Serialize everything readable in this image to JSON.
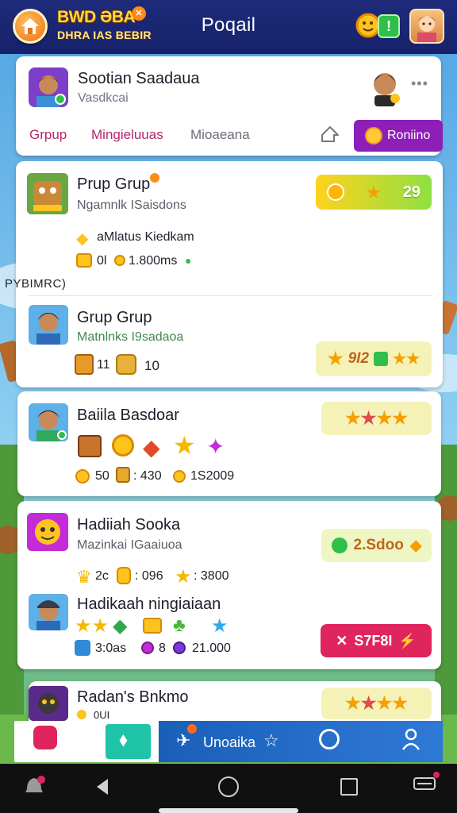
{
  "app": {
    "logo_line1": "BWD ƏBA",
    "logo_line2": "DHRA IAS BEBIR",
    "title": "Poqail"
  },
  "profile": {
    "name": "Sootian Saadaua",
    "subtitle": "Vasdkcai"
  },
  "tabs": [
    {
      "label": "Grpup"
    },
    {
      "label": "Mingieluuas"
    },
    {
      "label": "Mioaeana"
    }
  ],
  "promo_button": {
    "label": "Roniino"
  },
  "entries": [
    {
      "title": "Prup Grup",
      "subtitle": "Ngamnlk ISaisdons",
      "reward_label": "aMlatus Kiedkam",
      "stat_1": "0l",
      "stat_2": "1.800ms",
      "badge_value": "29"
    },
    {
      "title": "Grup Grup",
      "subtitle": "Matnlnks I9sadaoa",
      "stat_1": "11",
      "stat_2": "10",
      "badge_value": "9I2"
    },
    {
      "title": "Baiila Basdoar",
      "stat_1": "50",
      "stat_2": ": 430",
      "stat_3": "1S2009"
    },
    {
      "title": "Hadiiah Sooka",
      "subtitle": "Mazinkai IGaaiuoa",
      "stat_1": "2c",
      "stat_2": ": 096",
      "stat_3": ": 3800",
      "badge_value": "2.Sdoo"
    },
    {
      "title": "Hadikaah ningiaiaan",
      "stat_1": "3:0as",
      "stat_2": "8",
      "stat_3": "21.000",
      "badge_value": "S7F8I"
    },
    {
      "title": "Radan's Bnkmo",
      "stat_1": "0UI"
    }
  ],
  "section_label": "PYBIMRC)",
  "bottom_nav": {
    "active_label": "Unoaika"
  },
  "colors": {
    "header": "#1e2b7a",
    "accent_pink": "#b4256e",
    "promo_purple": "#8d1fb8",
    "nav_blue": "#1a5fb8",
    "teal": "#1fc4a8",
    "badge_red": "#e0245e"
  },
  "icons": [
    "home-icon",
    "coin-icon",
    "star-icon",
    "gem-icon",
    "chest-icon",
    "share-icon",
    "more-icon",
    "back-icon",
    "circle-home-icon",
    "recents-icon",
    "user-icon",
    "search-icon"
  ]
}
